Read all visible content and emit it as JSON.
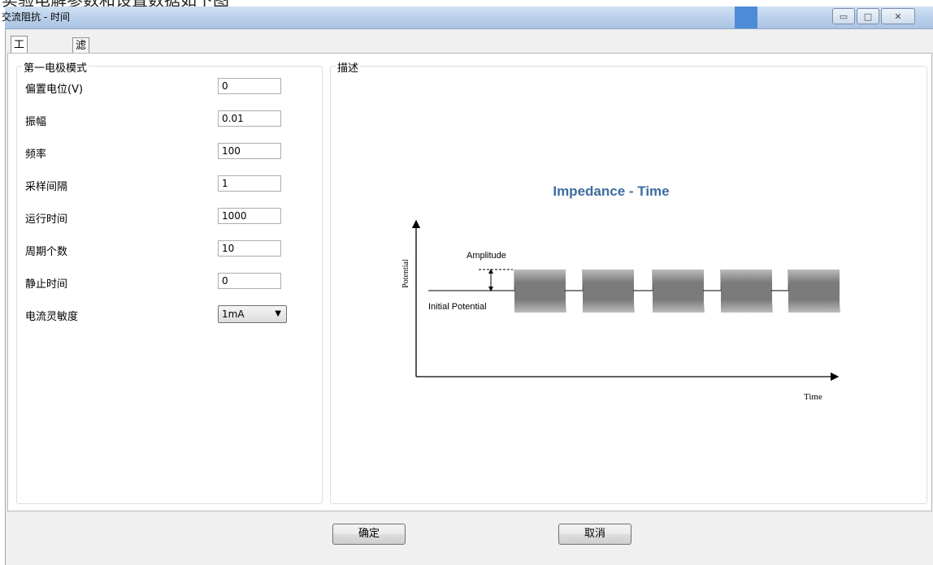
{
  "top_text": "实验电解参数和设置数据如下图",
  "window": {
    "title": "交流阻抗 - 时间",
    "controls": {
      "minimize": "▭",
      "maximize": "□",
      "close": "✕"
    }
  },
  "tabs": [
    {
      "label": "工作电极"
    },
    {
      "label": "滤波器"
    }
  ],
  "left_group": {
    "title": "第一电极模式",
    "fields": [
      {
        "label": "偏置电位(V)",
        "value": "0"
      },
      {
        "label": "振幅",
        "value": "0.01"
      },
      {
        "label": "频率",
        "value": "100"
      },
      {
        "label": "采样间隔",
        "value": "1"
      },
      {
        "label": "运行时间",
        "value": "1000"
      },
      {
        "label": "周期个数",
        "value": "10"
      },
      {
        "label": "静止时间",
        "value": "0"
      }
    ],
    "sensitivity": {
      "label": "电流灵敏度",
      "value": "1mA"
    }
  },
  "description_group": {
    "title": "描述",
    "diagram": {
      "title": "Impedance - Time",
      "ylabel": "Potential",
      "xlabel": "Time",
      "amplitude_label": "Amplitude",
      "initial_label": "Initial Potential",
      "title_color": "#3d6d9e",
      "bursts": 5
    }
  },
  "buttons": {
    "ok": "确定",
    "cancel": "取消"
  }
}
